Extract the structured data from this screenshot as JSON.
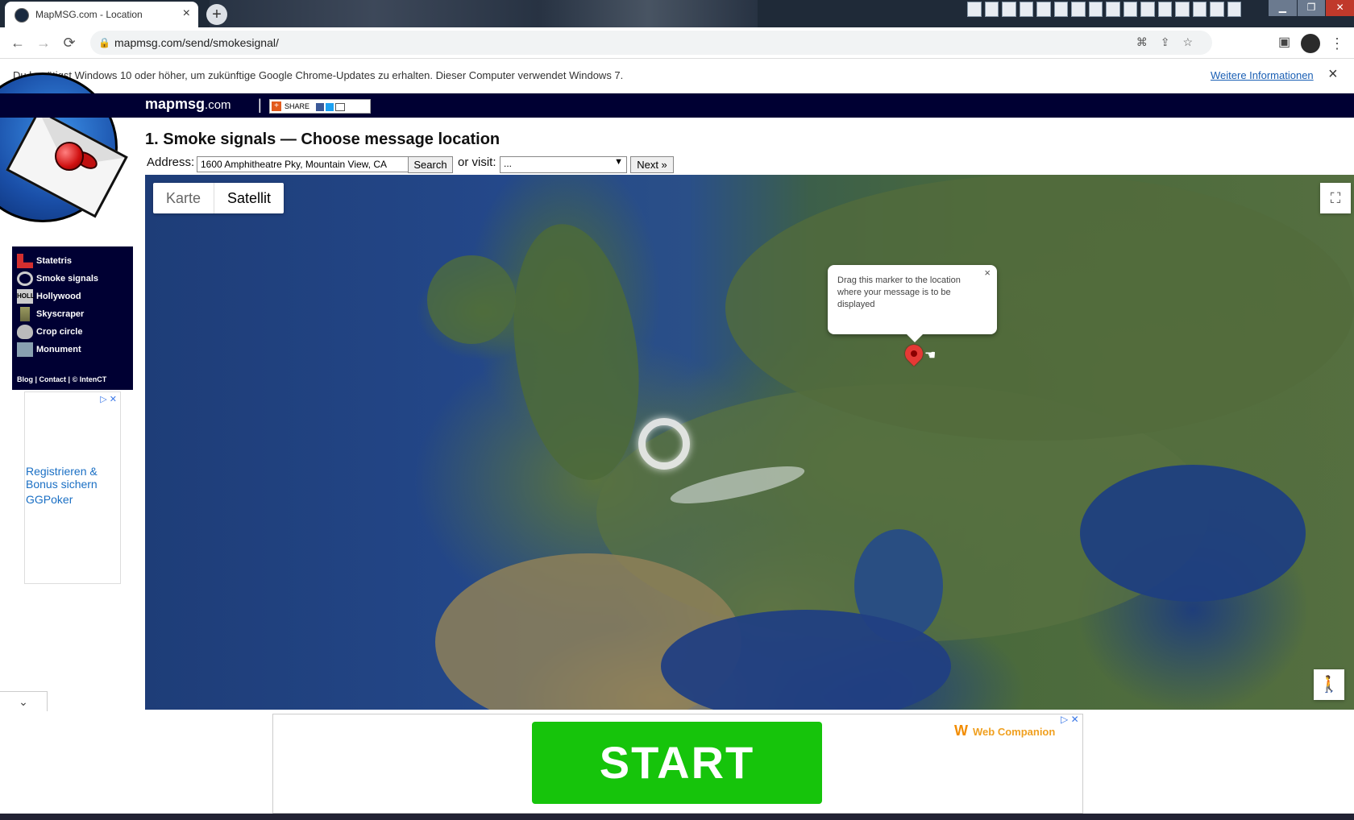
{
  "browser": {
    "tab_title": "MapMSG.com - Location",
    "tab_close": "×",
    "new_tab": "+",
    "url": "mapmsg.com/send/smokesignal/",
    "back": "←",
    "forward": "→",
    "reload": "⟳"
  },
  "infobar": {
    "message": "Du benötigst Windows 10 oder höher, um zukünftige Google Chrome-Updates zu erhalten. Dieser Computer verwendet Windows 7.",
    "link": "Weitere Informationen",
    "close": "×"
  },
  "site": {
    "logo_main": "mapmsg",
    "logo_suffix": ".com",
    "separator": "|",
    "share_label": "SHARE"
  },
  "nav": {
    "items": [
      {
        "label": "Statetris",
        "color": "#d32f2f"
      },
      {
        "label": "Smoke signals",
        "color": "#cccccc"
      },
      {
        "label": "Hollywood",
        "color": "#cccccc"
      },
      {
        "label": "Skyscraper",
        "color": "#9a9a60"
      },
      {
        "label": "Crop circle",
        "color": "#bbbbbb"
      },
      {
        "label": "Monument",
        "color": "#88a0b0"
      }
    ],
    "footer": {
      "blog": "Blog",
      "contact": "Contact",
      "copyright": "© IntenCT"
    }
  },
  "left_ad": {
    "line1": "Registrieren &",
    "line2": "Bonus sichern",
    "line3": "GGPoker",
    "choices": "▷ ✕"
  },
  "form": {
    "heading": "1. Smoke signals — Choose message location",
    "address_label": "Address:",
    "address_value": "1600 Amphitheatre Pky, Mountain View, CA",
    "search_label": "Search",
    "or_visit_label": "or visit:",
    "visit_selected": "...",
    "next_label": "Next »"
  },
  "map": {
    "type_map": "Karte",
    "type_satellite": "Satellit",
    "selected_type": "Satellit",
    "fullscreen_icon": "⛶",
    "pegman_icon": "🚶",
    "infowindow_text": "Drag this marker to the location where your message is to be displayed",
    "infowindow_close": "×"
  },
  "bottom_ad": {
    "button": "START",
    "brand": "Web Companion",
    "choices": "▷ ✕"
  },
  "collapse_icon": "⌄"
}
